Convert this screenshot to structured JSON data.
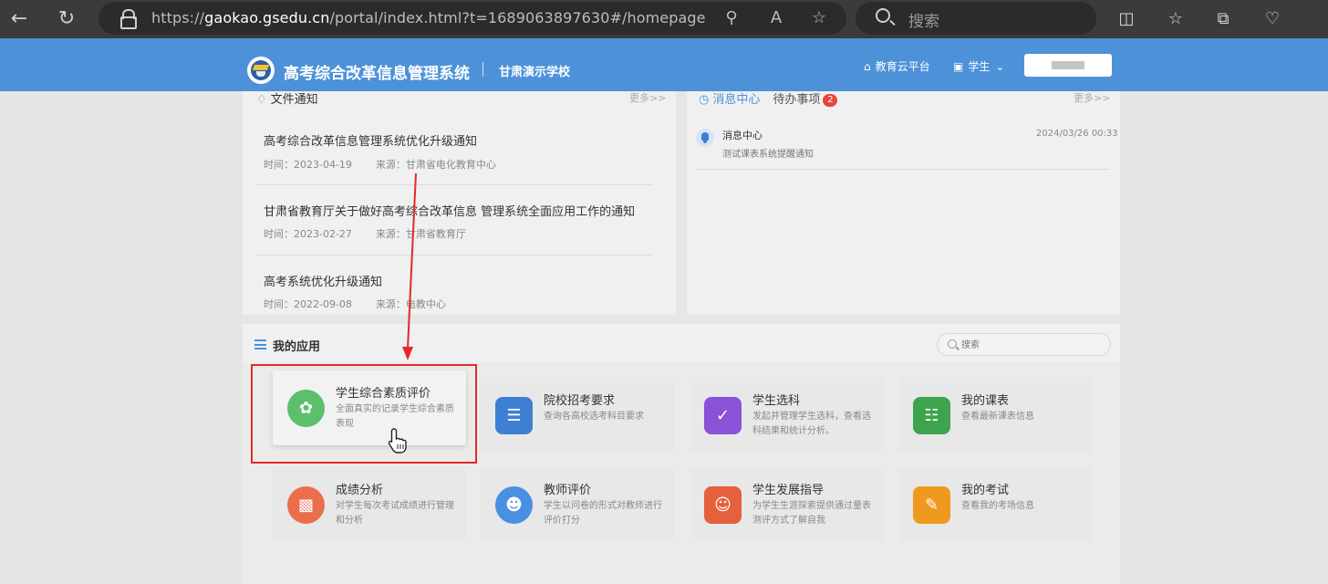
{
  "browser": {
    "url_prefix": "https://",
    "url_host": "gaokao.gsedu.cn",
    "url_path": "/portal/index.html?t=1689063897630#/homepage",
    "search_placeholder": "搜索",
    "icons": [
      "back-icon",
      "refresh-icon",
      "lock-icon",
      "zoom-icon",
      "read-aloud-icon",
      "favorite-star-icon",
      "search-icon",
      "split-screen-icon",
      "favorites-icon",
      "collections-icon",
      "browser-essentials-icon"
    ]
  },
  "header": {
    "title": "高考综合改革信息管理系统",
    "school": "甘肃演示学校",
    "cloud_link": "教育云平台",
    "role": "学生"
  },
  "notices": {
    "title": "文件通知",
    "more": "更多>>",
    "items": [
      {
        "title": "高考综合改革信息管理系统优化升级通知",
        "time": "时间：2023-04-19",
        "source": "来源：甘肃省电化教育中心"
      },
      {
        "title": "甘肃省教育厅关于做好高考综合改革信息 管理系统全面应用工作的通知",
        "time": "时间：2023-02-27",
        "source": "来源：甘肃省教育厅"
      },
      {
        "title": "高考系统优化升级通知",
        "time": "时间：2022-09-08",
        "source": "来源：电教中心"
      }
    ]
  },
  "messages": {
    "tab_active": "消息中心",
    "tab_other": "待办事项",
    "badge": "2",
    "more": "更多>>",
    "items": [
      {
        "title": "消息中心",
        "body": "测试课表系统提醒通知",
        "time": "2024/03/26 00:33"
      }
    ]
  },
  "apps": {
    "title": "我的应用",
    "search_placeholder": "搜索",
    "cards": [
      {
        "title": "学生综合素质评价",
        "desc": "全面真实的记录学生综合素质表现",
        "color": "#5cbf6b",
        "icon": "flower-icon"
      },
      {
        "title": "院校招考要求",
        "desc": "查询各高校选考科目要求",
        "color": "#3f7fd3",
        "icon": "document-search-icon"
      },
      {
        "title": "学生选科",
        "desc": "发起并管理学生选科，查看选科结果和统计分析。",
        "color": "#8a52d6",
        "icon": "monitor-check-icon"
      },
      {
        "title": "我的课表",
        "desc": "查看最新课表信息",
        "color": "#3ea34f",
        "icon": "book-icon"
      },
      {
        "title": "成绩分析",
        "desc": "对学生每次考试成绩进行管理和分析",
        "color": "#ea6e4b",
        "icon": "bar-chart-icon"
      },
      {
        "title": "教师评价",
        "desc": "学生以问卷的形式对教师进行评价打分",
        "color": "#4a90e2",
        "icon": "teacher-icon"
      },
      {
        "title": "学生发展指导",
        "desc": "为学生生涯探索提供通过量表测评方式了解自我",
        "color": "#e5603c",
        "icon": "reading-person-icon"
      },
      {
        "title": "我的考试",
        "desc": "查看我的考场信息",
        "color": "#ef9a1e",
        "icon": "exam-paper-icon"
      }
    ]
  }
}
